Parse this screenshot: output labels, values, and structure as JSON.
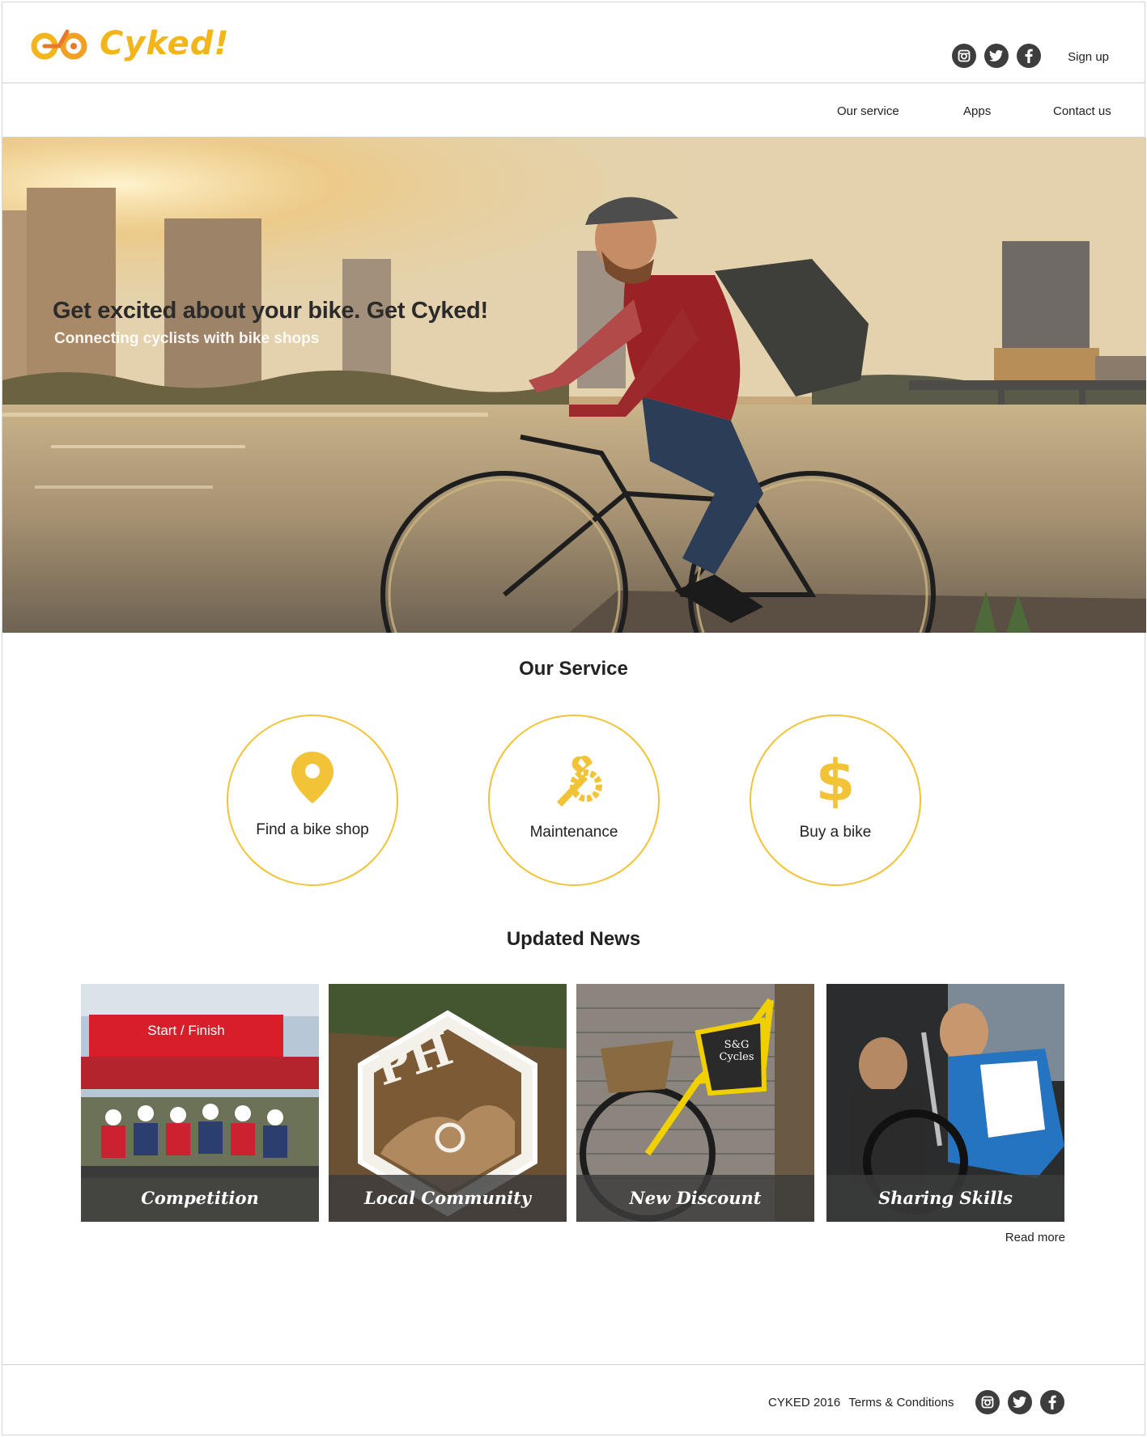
{
  "brand": {
    "name": "Cyked!",
    "accent": "#f2b51c"
  },
  "header": {
    "signup_label": "Sign up",
    "social_icons": [
      "instagram-icon",
      "twitter-icon",
      "facebook-icon"
    ]
  },
  "nav": {
    "items": [
      "Our service",
      "Apps",
      "Contact us"
    ]
  },
  "hero": {
    "title": "Get excited about your bike. Get Cyked!",
    "subtitle": "Connecting cyclists with bike shops"
  },
  "service": {
    "title": "Our Service",
    "items": [
      {
        "label": "Find a bike shop",
        "icon": "map-pin-icon"
      },
      {
        "label": "Maintenance",
        "icon": "wrench-gear-icon"
      },
      {
        "label": "Buy a bike",
        "icon": "dollar-icon"
      }
    ]
  },
  "news": {
    "title": "Updated News",
    "items": [
      {
        "caption": "Competition",
        "sign_text": "Start / Finish"
      },
      {
        "caption": "Local Community",
        "badge_text": "PH"
      },
      {
        "caption": "New Discount",
        "sign_text": "S&G Cycles"
      },
      {
        "caption": "Sharing Skills"
      }
    ],
    "read_more": "Read more"
  },
  "footer": {
    "copyright": "CYKED 2016",
    "terms": "Terms & Conditions",
    "social_icons": [
      "instagram-icon",
      "twitter-icon",
      "facebook-icon"
    ]
  }
}
